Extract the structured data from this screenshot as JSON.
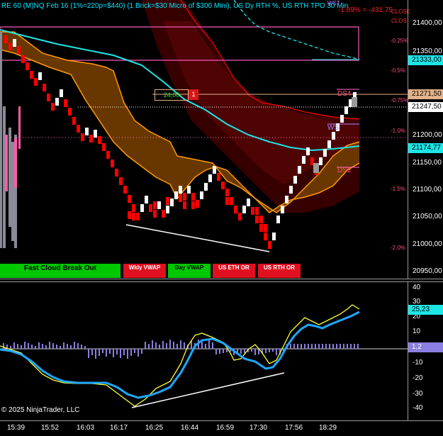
{
  "chart": {
    "title": "RE 60 (M)NQ Feb 16  (1%=220p=$440) (1 Brick=$30 Micro of $300 Mini), US Dy RTH %, US RTH TPO 30 Min",
    "pnl_label": "-1.89% = -431.75",
    "top_right_labels": [
      "WST",
      "CLOSE",
      "CLOS"
    ],
    "level_labels": {
      "ds4": "DS4",
      "ds2": "DS2",
      "ws": "WS"
    },
    "percent_labels": [
      "-0.25%",
      "-0.5%",
      "-0.75%",
      "-1.0%",
      "-1.5%",
      "-2.0%"
    ],
    "order_box": {
      "qty": "24,00",
      "side": "1"
    },
    "copyright": "© 2025 NinjaTrader, LLC"
  },
  "price_axis": {
    "ticks": [
      "21400,00",
      "21350,00",
      "21200,00",
      "21150,00",
      "21100,00",
      "21050,00",
      "21000,00",
      "20950,00"
    ],
    "tags": [
      {
        "text": "21333,00",
        "bg": "#1ce6e6",
        "fg": "#000000"
      },
      {
        "text": "21271,50",
        "bg": "#e3b28a",
        "fg": "#000000"
      },
      {
        "text": "21247,50",
        "bg": "#ffffff",
        "fg": "#000000"
      },
      {
        "text": "21174,77",
        "bg": "#1ce6e6",
        "fg": "#000000"
      }
    ]
  },
  "osc_axis": {
    "ticks": [
      "40",
      "30",
      "20",
      "10",
      "-10",
      "-20",
      "-30",
      "-40"
    ],
    "tags": [
      {
        "text": "25,23",
        "bg": "#1ce6e6",
        "fg": "#000000"
      },
      {
        "text": "1,2",
        "bg": "#8a7fe0",
        "fg": "#ffffff"
      }
    ]
  },
  "time_axis": {
    "labels": [
      "15:39",
      "15:52",
      "16:03",
      "16:17",
      "16:25",
      "16:44",
      "16:59",
      "17:30",
      "17:56",
      "18:29"
    ]
  },
  "buttons": [
    {
      "label": "Fast Cloud Break Out",
      "bg": "#00c800",
      "fg": "#000000"
    },
    {
      "label": "Wkly VWAP",
      "bg": "#e01020",
      "fg": "#ffffff"
    },
    {
      "label": "Day VWAP",
      "bg": "#00c800",
      "fg": "#000000"
    },
    {
      "label": "US ETH OR",
      "bg": "#e01020",
      "fg": "#ffffff"
    },
    {
      "label": "US RTH OR",
      "bg": "#e01020",
      "fg": "#ffffff"
    }
  ],
  "colors": {
    "up_brick": "#ffffff",
    "down_brick": "#ff0000",
    "cloud_orange": "#ff9a00",
    "cyan_line": "#1ce6e6",
    "red_line": "#ff0000",
    "osc_yellow": "#ffff33",
    "osc_blue": "#1ea7ff",
    "histogram": "#8a7fe0"
  }
}
